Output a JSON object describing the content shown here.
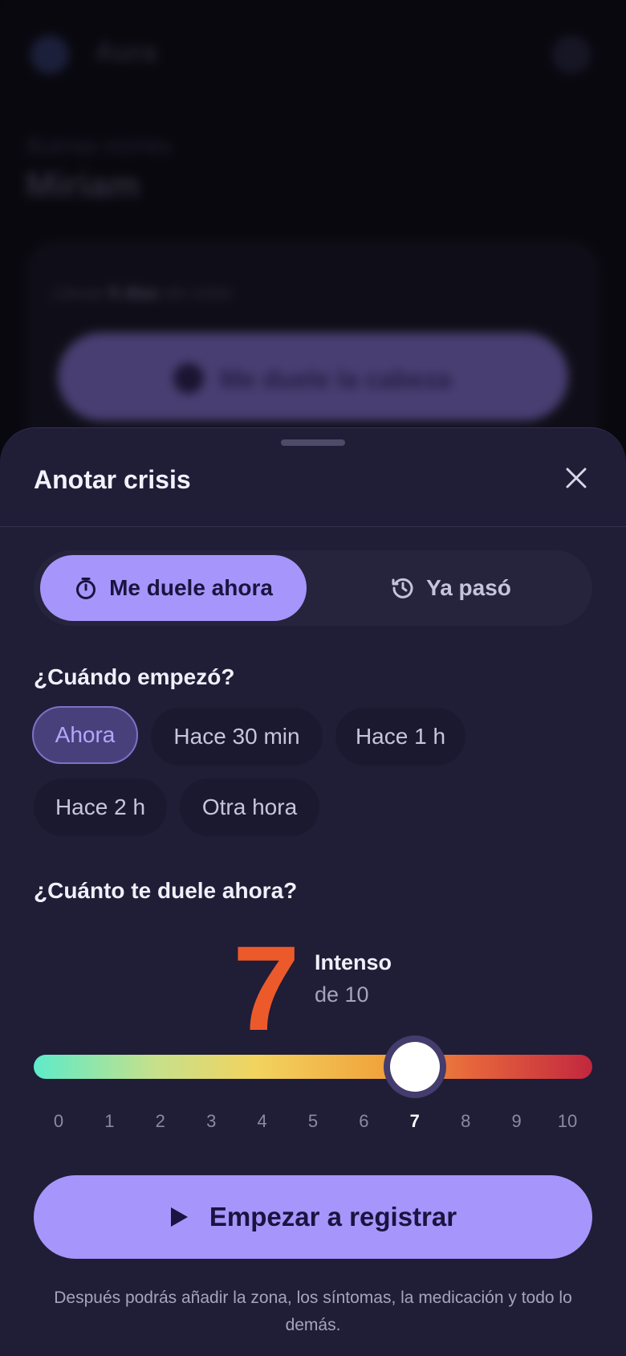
{
  "background": {
    "app_name": "Aura",
    "greeting": "Buenas noches",
    "user_name": "Miriam",
    "card_text_prefix": "Llevas ",
    "card_text_bold": "5 días",
    "card_text_suffix": " sin crisis",
    "card_button_label": "Me duele la cabeza"
  },
  "sheet": {
    "title": "Anotar crisis",
    "close_icon": "close-icon",
    "mode_options": [
      {
        "label": "Me duele ahora",
        "icon": "stopwatch-icon",
        "selected": true
      },
      {
        "label": "Ya pasó",
        "icon": "history-icon",
        "selected": false
      }
    ],
    "start_question": "¿Cuándo empezó?",
    "start_options": [
      {
        "label": "Ahora",
        "selected": true
      },
      {
        "label": "Hace 30 min",
        "selected": false
      },
      {
        "label": "Hace 1 h",
        "selected": false
      },
      {
        "label": "Hace 2 h",
        "selected": false
      },
      {
        "label": "Otra hora",
        "selected": false
      }
    ],
    "pain_question": "¿Cuánto te duele ahora?",
    "pain": {
      "value": 7,
      "value_text": "7",
      "level_label": "Intenso",
      "scale_text": "de 10",
      "min": 0,
      "max": 10,
      "ticks": [
        "0",
        "1",
        "2",
        "3",
        "4",
        "5",
        "6",
        "7",
        "8",
        "9",
        "10"
      ]
    },
    "cta_label": "Empezar a registrar",
    "cta_icon": "play-icon",
    "footnote": "Después podrás añadir la zona, los síntomas, la medicación y todo lo demás."
  },
  "colors": {
    "accent": "#a695fa",
    "pain_value": "#ec5a2b",
    "sheet_bg": "#201d37"
  }
}
